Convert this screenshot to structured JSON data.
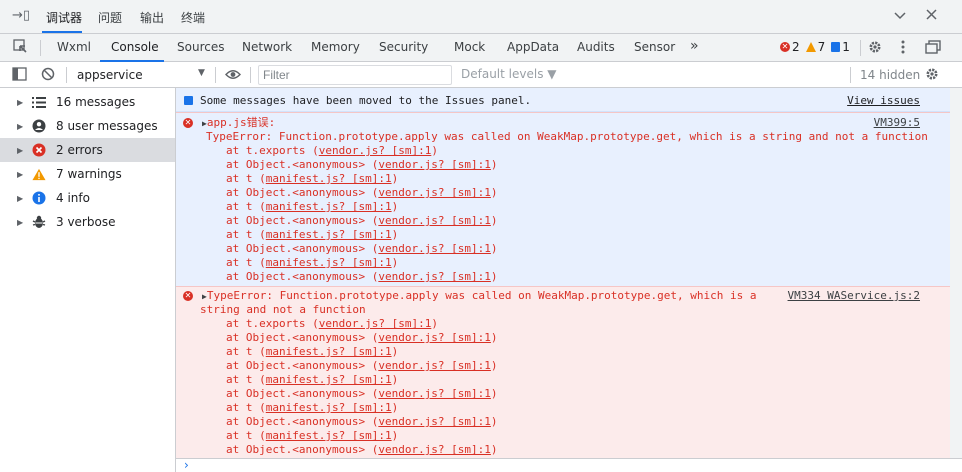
{
  "topbar": {
    "dock_icon": "dock-side-icon",
    "tabs": [
      {
        "label": "调试器",
        "active": true
      },
      {
        "label": "问题",
        "active": false
      },
      {
        "label": "输出",
        "active": false
      },
      {
        "label": "终端",
        "active": false
      }
    ],
    "chevron_icon": "chevron-down-icon",
    "close_icon": "close-icon"
  },
  "tabbar": {
    "inspect_icon": "inspect-element-icon",
    "tabs": [
      "Wxml",
      "Console",
      "Sources",
      "Network",
      "Memory",
      "Security",
      "Mock",
      "AppData",
      "Audits",
      "Sensor"
    ],
    "more_label": "»",
    "errors_count": "2",
    "warnings_count": "7",
    "info_count": "1",
    "settings_icon": "gear-icon",
    "menu_icon": "kebab-menu-icon",
    "undock_icon": "undock-icon"
  },
  "filterbar": {
    "sidebar_toggle_icon": "sidebar-toggle-icon",
    "clear_icon": "clear-console-icon",
    "context": "appservice",
    "eye_icon": "eye-icon",
    "filter_placeholder": "Filter",
    "levels_label": "Default levels ▼",
    "hidden_label": "14 hidden",
    "settings_icon": "gear-icon"
  },
  "sidebar": {
    "items": [
      {
        "label": "16 messages",
        "icon": "list-icon",
        "selected": false
      },
      {
        "label": "8 user messages",
        "icon": "user-icon",
        "selected": false
      },
      {
        "label": "2 errors",
        "icon": "error-icon",
        "selected": true
      },
      {
        "label": "7 warnings",
        "icon": "warning-icon",
        "selected": false
      },
      {
        "label": "4 info",
        "icon": "info-icon",
        "selected": false
      },
      {
        "label": "3 verbose",
        "icon": "bug-icon",
        "selected": false
      }
    ]
  },
  "console": {
    "info_message": "Some messages have been moved to the Issues panel.",
    "info_link": "View issues",
    "error1": {
      "title": "app.js错误:",
      "source": "VM399:5",
      "message": "TypeError: Function.prototype.apply was called on WeakMap.prototype.get, which is a string and not a function",
      "stack": [
        {
          "at": "at t.exports",
          "loc": "vendor.js? [sm]:1"
        },
        {
          "at": "at Object.<anonymous>",
          "loc": "vendor.js? [sm]:1"
        },
        {
          "at": "at t",
          "loc": "manifest.js? [sm]:1"
        },
        {
          "at": "at Object.<anonymous>",
          "loc": "vendor.js? [sm]:1"
        },
        {
          "at": "at t",
          "loc": "manifest.js? [sm]:1"
        },
        {
          "at": "at Object.<anonymous>",
          "loc": "vendor.js? [sm]:1"
        },
        {
          "at": "at t",
          "loc": "manifest.js? [sm]:1"
        },
        {
          "at": "at Object.<anonymous>",
          "loc": "vendor.js? [sm]:1"
        },
        {
          "at": "at t",
          "loc": "manifest.js? [sm]:1"
        },
        {
          "at": "at Object.<anonymous>",
          "loc": "vendor.js? [sm]:1"
        }
      ]
    },
    "error2": {
      "message_line1": "TypeError: Function.prototype.apply was called on WeakMap.prototype.get, which is a",
      "message_line2": "string and not a function",
      "source": "VM334 WAService.js:2",
      "stack": [
        {
          "at": "at t.exports",
          "loc": "vendor.js? [sm]:1"
        },
        {
          "at": "at Object.<anonymous>",
          "loc": "vendor.js? [sm]:1"
        },
        {
          "at": "at t",
          "loc": "manifest.js? [sm]:1"
        },
        {
          "at": "at Object.<anonymous>",
          "loc": "vendor.js? [sm]:1"
        },
        {
          "at": "at t",
          "loc": "manifest.js? [sm]:1"
        },
        {
          "at": "at Object.<anonymous>",
          "loc": "vendor.js? [sm]:1"
        },
        {
          "at": "at t",
          "loc": "manifest.js? [sm]:1"
        },
        {
          "at": "at Object.<anonymous>",
          "loc": "vendor.js? [sm]:1"
        },
        {
          "at": "at t",
          "loc": "manifest.js? [sm]:1"
        },
        {
          "at": "at Object.<anonymous>",
          "loc": "vendor.js? [sm]:1"
        }
      ]
    },
    "prompt_symbol": "›"
  },
  "colors": {
    "accent": "#1a73e8",
    "error": "#d93025",
    "warning": "#f29900",
    "error_bg": "#fcebeb",
    "info_bg": "#e8f0fe"
  }
}
